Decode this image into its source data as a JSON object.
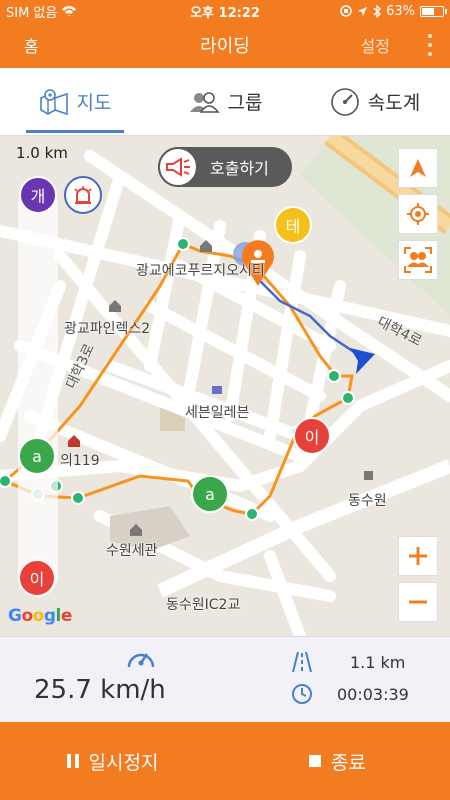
{
  "status_bar": {
    "carrier": "SIM 없음",
    "time": "오후 12:22",
    "battery": "63%",
    "battery_level": 0.63
  },
  "nav": {
    "home": "홈",
    "title": "라이딩",
    "settings": "설정"
  },
  "tabs": [
    {
      "label": "지도",
      "icon": "map-icon",
      "active": true
    },
    {
      "label": "그룹",
      "icon": "group-icon",
      "active": false
    },
    {
      "label": "속도계",
      "icon": "speedometer-icon",
      "active": false
    }
  ],
  "map": {
    "scale": "1.0 km",
    "call_button": "호출하기",
    "markers": {
      "top": "개",
      "member_te": "테",
      "member_a_left": "a",
      "member_a_mid": "a",
      "member_i_right": "이",
      "bottom": "이"
    },
    "places": {
      "ecopark": "광교에코푸르지오시티",
      "pinerex": "광교파인렉스2",
      "seven_eleven": "세븐일레븐",
      "fire_119": "의119",
      "dongsuwon": "동수원",
      "suwon_tax": "수원세관",
      "ic": "동수원IC2교",
      "daehak_right": "대학4로",
      "daehak_left": "대학3로"
    },
    "google": [
      "G",
      "o",
      "o",
      "g",
      "l",
      "e"
    ],
    "colors": {
      "route_orange": "#f7941d",
      "route_blue": "#4668c5",
      "marker_purple": "#6a35b0",
      "marker_green": "#3aa84a",
      "marker_red": "#e8413a",
      "marker_yellow": "#f6c01a",
      "accent_orange": "#f47c20"
    }
  },
  "stats": {
    "speed": "25.7 km/h",
    "distance": "1.1 km",
    "elapsed": "00:03:39"
  },
  "bottom": {
    "pause": "일시정지",
    "stop": "종료"
  }
}
